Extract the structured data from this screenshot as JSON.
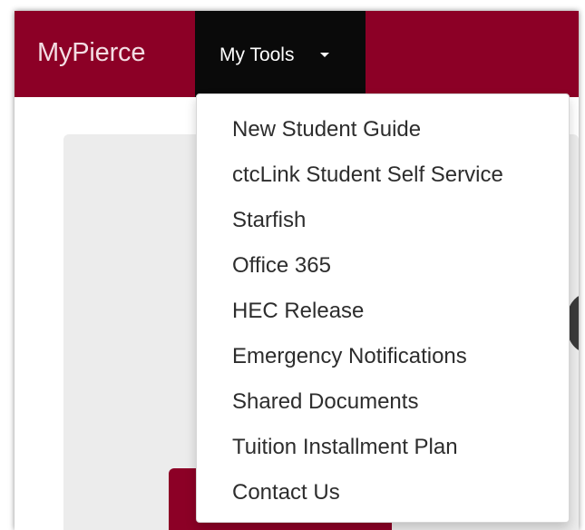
{
  "navbar": {
    "brand": "MyPierce",
    "tools_label": "My Tools",
    "color": "#8c0026"
  },
  "dropdown": {
    "items": [
      {
        "label": "New Student Guide"
      },
      {
        "label": "ctcLink Student Self Service"
      },
      {
        "label": "Starfish"
      },
      {
        "label": "Office 365"
      },
      {
        "label": "HEC Release"
      },
      {
        "label": "Emergency Notifications"
      },
      {
        "label": "Shared Documents"
      },
      {
        "label": "Tuition Installment Plan"
      },
      {
        "label": "Contact Us"
      }
    ]
  }
}
